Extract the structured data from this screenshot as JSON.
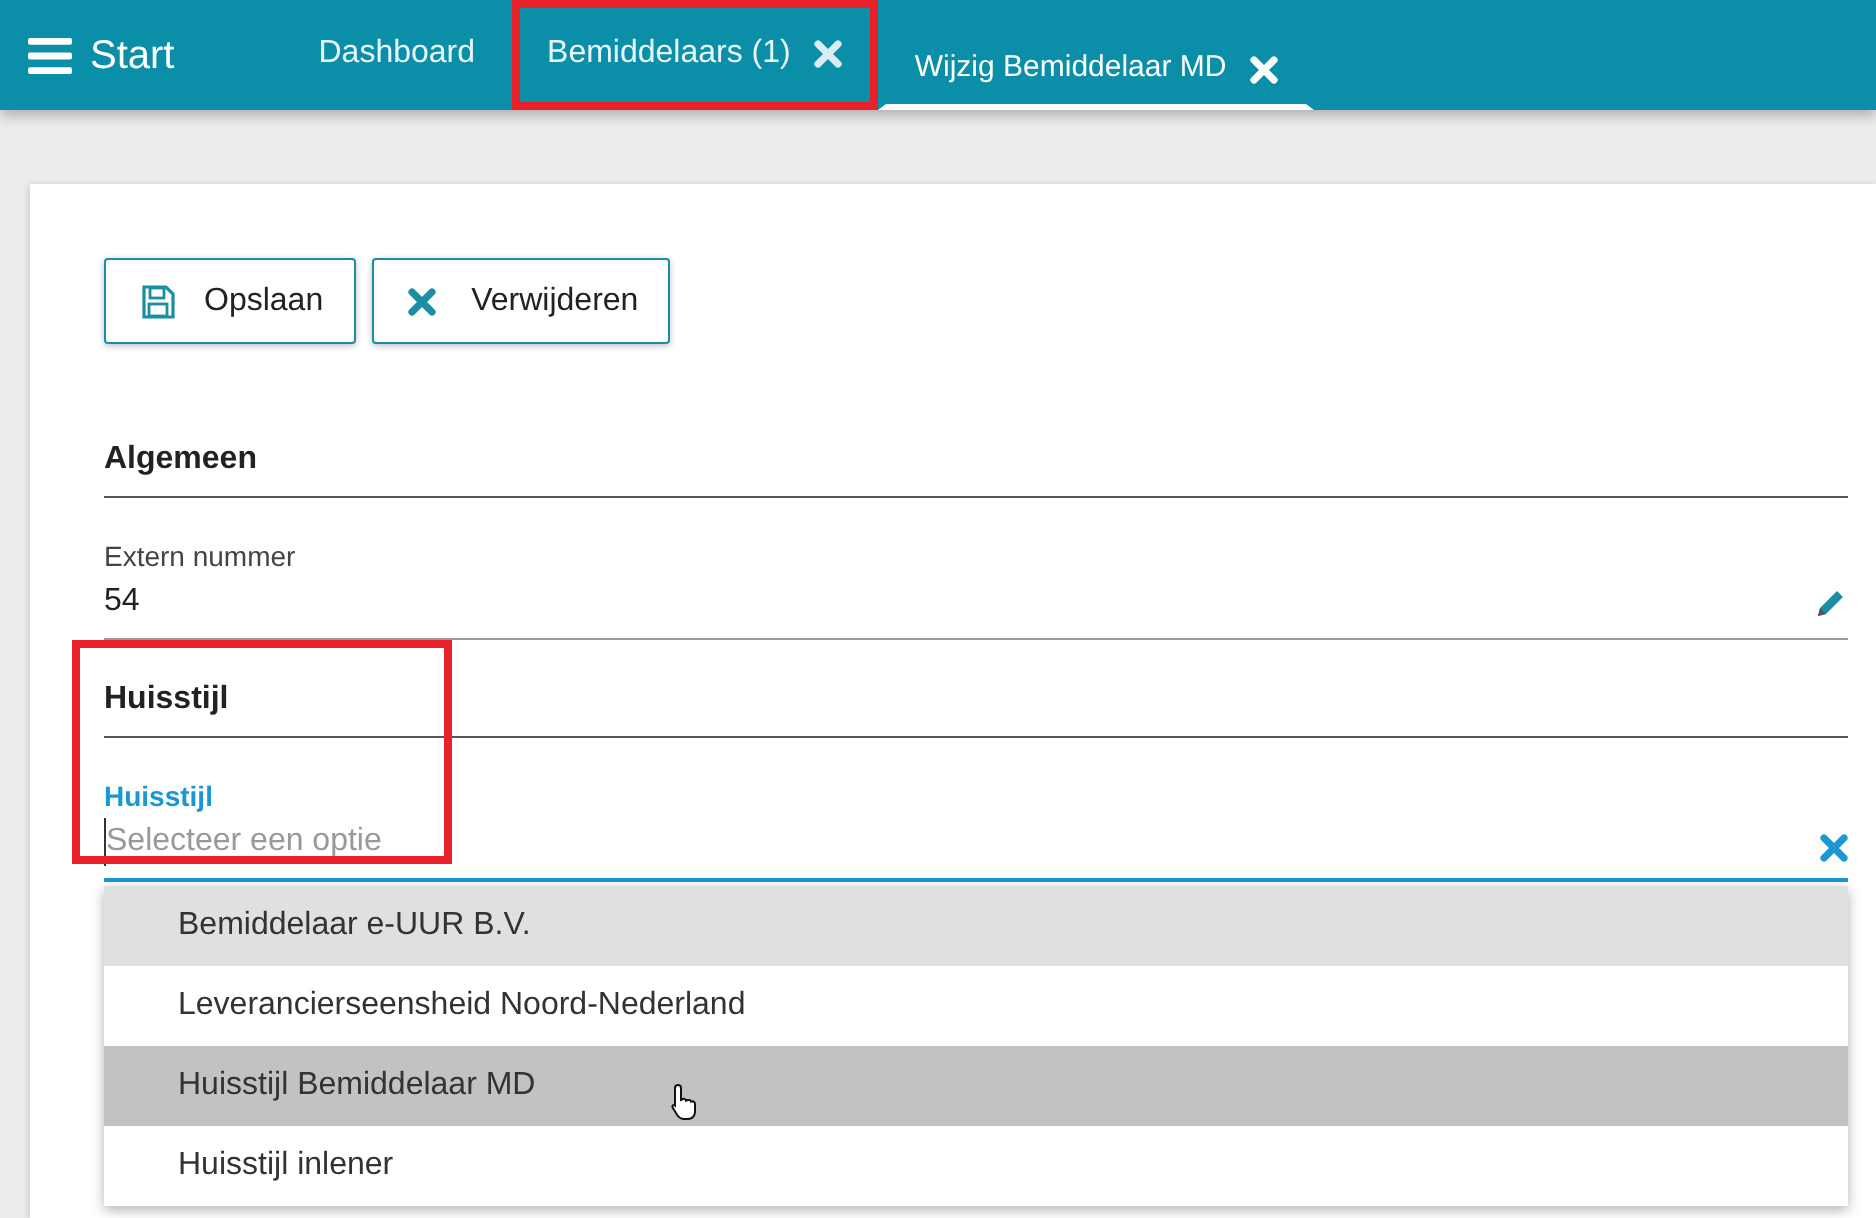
{
  "topbar": {
    "menu_label": "Start"
  },
  "tabs": [
    {
      "label": "Dashboard",
      "selected": false,
      "closable": false,
      "highlighted": false
    },
    {
      "label": "Bemiddelaars (1)",
      "selected": false,
      "closable": true,
      "highlighted": true
    },
    {
      "label": "Wijzig Bemiddelaar MD",
      "selected": true,
      "closable": true,
      "highlighted": false
    }
  ],
  "toolbar": [
    {
      "label": "Opslaan",
      "kind": "save"
    },
    {
      "label": "Verwijderen",
      "kind": "delete"
    }
  ],
  "sections": [
    {
      "title": "Algemeen",
      "highlighted": false,
      "fields": [
        {
          "label": "Extern nummer",
          "value": "54",
          "focused": false,
          "kind": "edit"
        }
      ]
    },
    {
      "title": "Huisstijl",
      "highlighted": true,
      "fields": [
        {
          "label": "Huisstijl",
          "placeholder": "Selecteer een optie",
          "focused": true,
          "kind": "select",
          "options": [
            {
              "label": "Bemiddelaar e-UUR B.V.",
              "highlighted": true,
              "hovered": false
            },
            {
              "label": "Leverancierseensheid Noord-Nederland",
              "highlighted": false,
              "hovered": false
            },
            {
              "label": "Huisstijl Bemiddelaar MD",
              "highlighted": false,
              "hovered": true
            },
            {
              "label": "Huisstijl inlener",
              "highlighted": false,
              "hovered": false
            }
          ]
        }
      ]
    }
  ]
}
